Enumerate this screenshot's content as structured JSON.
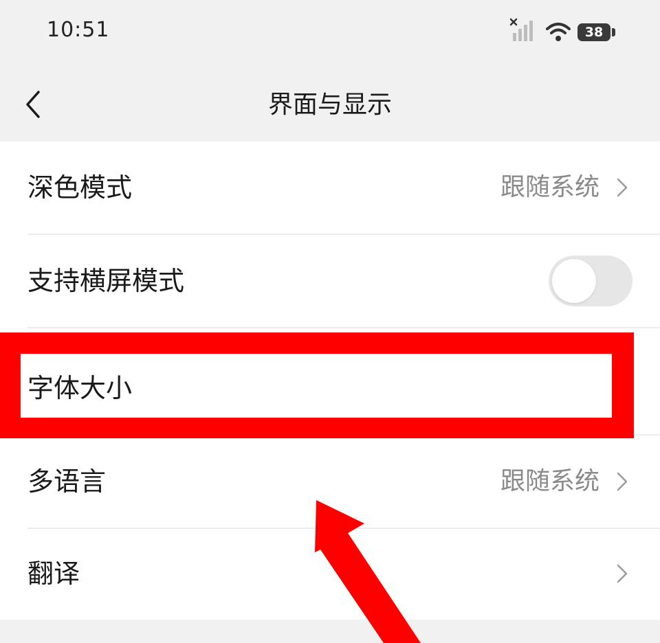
{
  "status_bar": {
    "time": "10:51",
    "battery_level": "38",
    "icons": [
      "signal-no-service-icon",
      "wifi-icon",
      "battery-icon"
    ]
  },
  "header": {
    "title": "界面与显示",
    "back_icon": "chevron-left-icon"
  },
  "settings": {
    "dark_mode": {
      "label": "深色模式",
      "value": "跟随系统"
    },
    "landscape": {
      "label": "支持横屏模式",
      "enabled": false
    },
    "font_size": {
      "label": "字体大小"
    },
    "language": {
      "label": "多语言",
      "value": "跟随系统"
    },
    "translate": {
      "label": "翻译"
    }
  },
  "annotation": {
    "highlight_color": "#ff0000",
    "highlighted_item": "字体大小"
  },
  "colors": {
    "background": "#f1f1f1",
    "card": "#ffffff",
    "secondary_text": "#8a8a8a",
    "toggle_off": "#e6e6e6"
  }
}
